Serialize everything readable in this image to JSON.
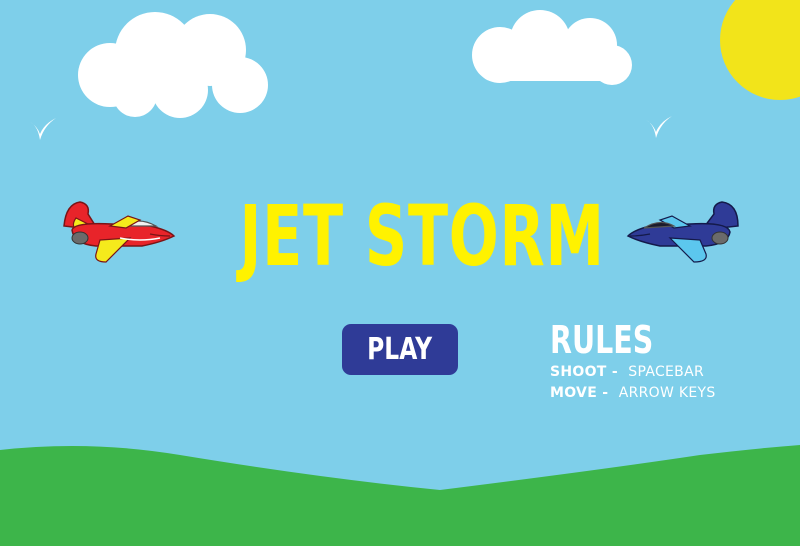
{
  "game": {
    "title": "JET STORM",
    "play_label": "PLAY",
    "rules": {
      "heading": "RULES",
      "items": [
        {
          "key": "SHOOT",
          "sep": " -  ",
          "value": "SPACEBAR"
        },
        {
          "key": "MOVE",
          "sep": " -  ",
          "value": "ARROW KEYS"
        }
      ]
    }
  },
  "colors": {
    "sky": "#7ecfea",
    "grass": "#3db54a",
    "sun": "#f2e41a",
    "title": "#fff200",
    "play_button": "#2f3b97",
    "red_plane": "#e8242a",
    "blue_plane": "#2f3b97"
  }
}
